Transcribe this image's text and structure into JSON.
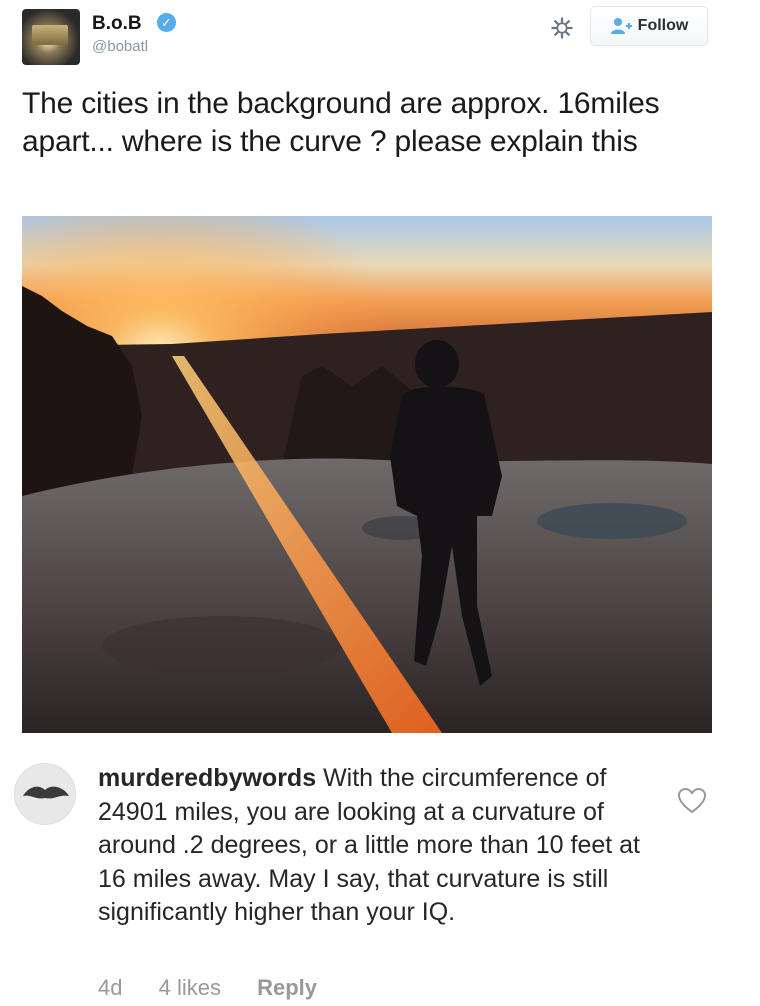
{
  "tweet": {
    "display_name": "B.o.B",
    "handle": "@bobatl",
    "verified_icon": "verified-badge-icon",
    "settings_icon": "gear-icon",
    "follow_label": "Follow",
    "follow_icon": "add-user-icon",
    "text": "The cities in the background are approx. 16miles apart... where is the curve ? please explain this",
    "photo_icon": "sunset-photo"
  },
  "comment": {
    "username": "murderedbywords",
    "text": "With the circumference of 24901 miles, you are looking at a curvature of around .2 degrees, or a little more than 10 feet at 16 miles away. May I say, that curvature is still significantly higher than your IQ.",
    "time": "4d",
    "likes": "4 likes",
    "reply_label": "Reply",
    "like_icon": "heart-icon"
  },
  "colors": {
    "accent": "#55acee",
    "handle": "#8899a6",
    "meta": "#999999"
  }
}
